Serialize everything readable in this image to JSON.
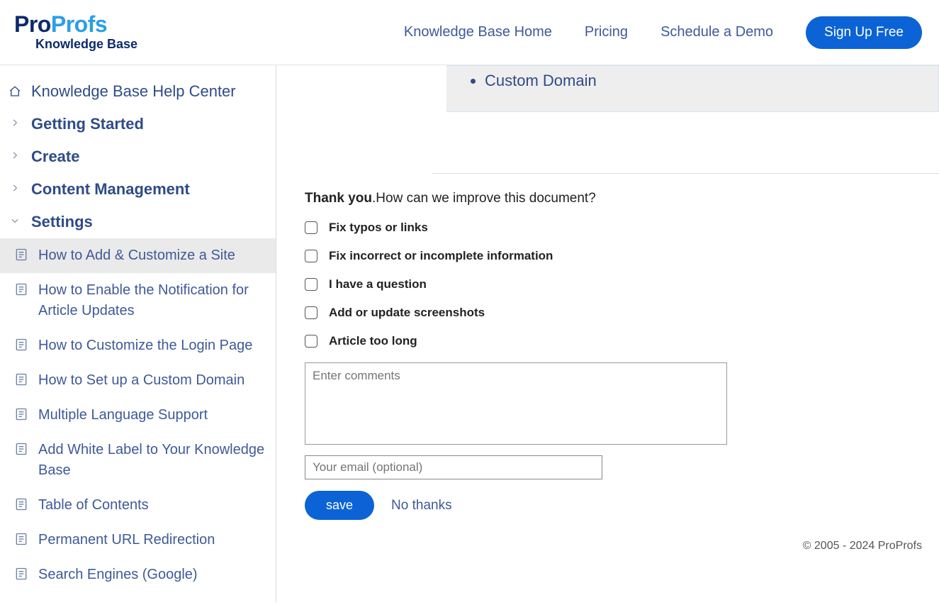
{
  "brand": {
    "part1": "Pro",
    "part2": "Profs",
    "sub": "Knowledge Base"
  },
  "nav": {
    "home": "Knowledge Base Home",
    "pricing": "Pricing",
    "demo": "Schedule a Demo",
    "cta": "Sign Up Free"
  },
  "sidebar": {
    "root": "Knowledge Base Help Center",
    "sections": {
      "getting_started": "Getting Started",
      "create": "Create",
      "content_mgmt": "Content Management",
      "settings": "Settings"
    },
    "settings_items": [
      "How to Add & Customize a Site",
      "How to Enable the Notification for Article Updates",
      "How to Customize the Login Page",
      "How to Set up a Custom Domain",
      "Multiple Language Support",
      "Add White Label to Your Knowledge Base",
      "Table of Contents",
      "Permanent URL Redirection",
      "Search Engines (Google)"
    ]
  },
  "bullet": "Custom Domain",
  "feedback": {
    "thank": "Thank you",
    "question": ".How can we improve this document?",
    "options": [
      "Fix typos or links",
      "Fix incorrect or incomplete information",
      "I have a question",
      "Add or update screenshots",
      "Article too long"
    ],
    "comments_ph": "Enter comments",
    "email_ph": "Your email (optional)",
    "save": "save",
    "nothanks": "No thanks"
  },
  "footer": "© 2005 - 2024 ProProfs"
}
